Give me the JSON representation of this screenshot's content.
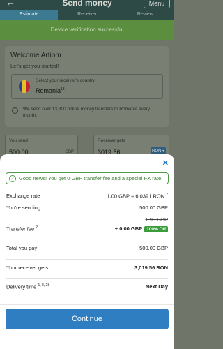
{
  "header": {
    "title": "Send money",
    "menu_label": "Menu",
    "back_glyph": "←"
  },
  "tabs": [
    {
      "label": "Estimate",
      "active": true
    },
    {
      "label": "Receiver",
      "active": false
    },
    {
      "label": "Review",
      "active": false
    }
  ],
  "verification": {
    "message": "Device verification successful"
  },
  "welcome": {
    "heading": "Welcome Artiom",
    "subheading": "Let's get you started!",
    "country_label": "Select your receiver's country",
    "country_value": "Romania",
    "country_sup": "18",
    "note": "We send over 13,800 online money transfers to Romania every month."
  },
  "amounts": {
    "send_label": "You send",
    "send_value": "500.00",
    "send_currency": "GBP",
    "receive_label": "Receiver gets",
    "receive_value": "3019.56",
    "receive_currency": "RON"
  },
  "sheet": {
    "close_glyph": "✕",
    "banner": "Good news! You get 0 GBP transfer fee and a special FX rate.",
    "rows": {
      "exchange_rate": {
        "label": "Exchange rate",
        "value": "1.00 GBP = 6.0391 RON",
        "sup": "2"
      },
      "sending": {
        "label": "You're sending",
        "value": "500.00 GBP"
      },
      "fee": {
        "label": "Transfer fee",
        "label_sup": "2",
        "old_value": "1.99 GBP",
        "value": "+ 0.00 GBP",
        "badge": "100% Off"
      },
      "total": {
        "label": "Total you pay",
        "value": "500.00 GBP"
      },
      "receiver": {
        "label": "Your receiver gets",
        "value": "3,019.56 RON"
      },
      "delivery": {
        "label": "Delivery time",
        "label_sup": "1, 8, 28",
        "value": "Next Day"
      }
    },
    "continue_label": "Continue"
  },
  "colors": {
    "accent": "#2f7ec1",
    "success": "#3b9a3b",
    "header_bg": "#2e4a47"
  }
}
